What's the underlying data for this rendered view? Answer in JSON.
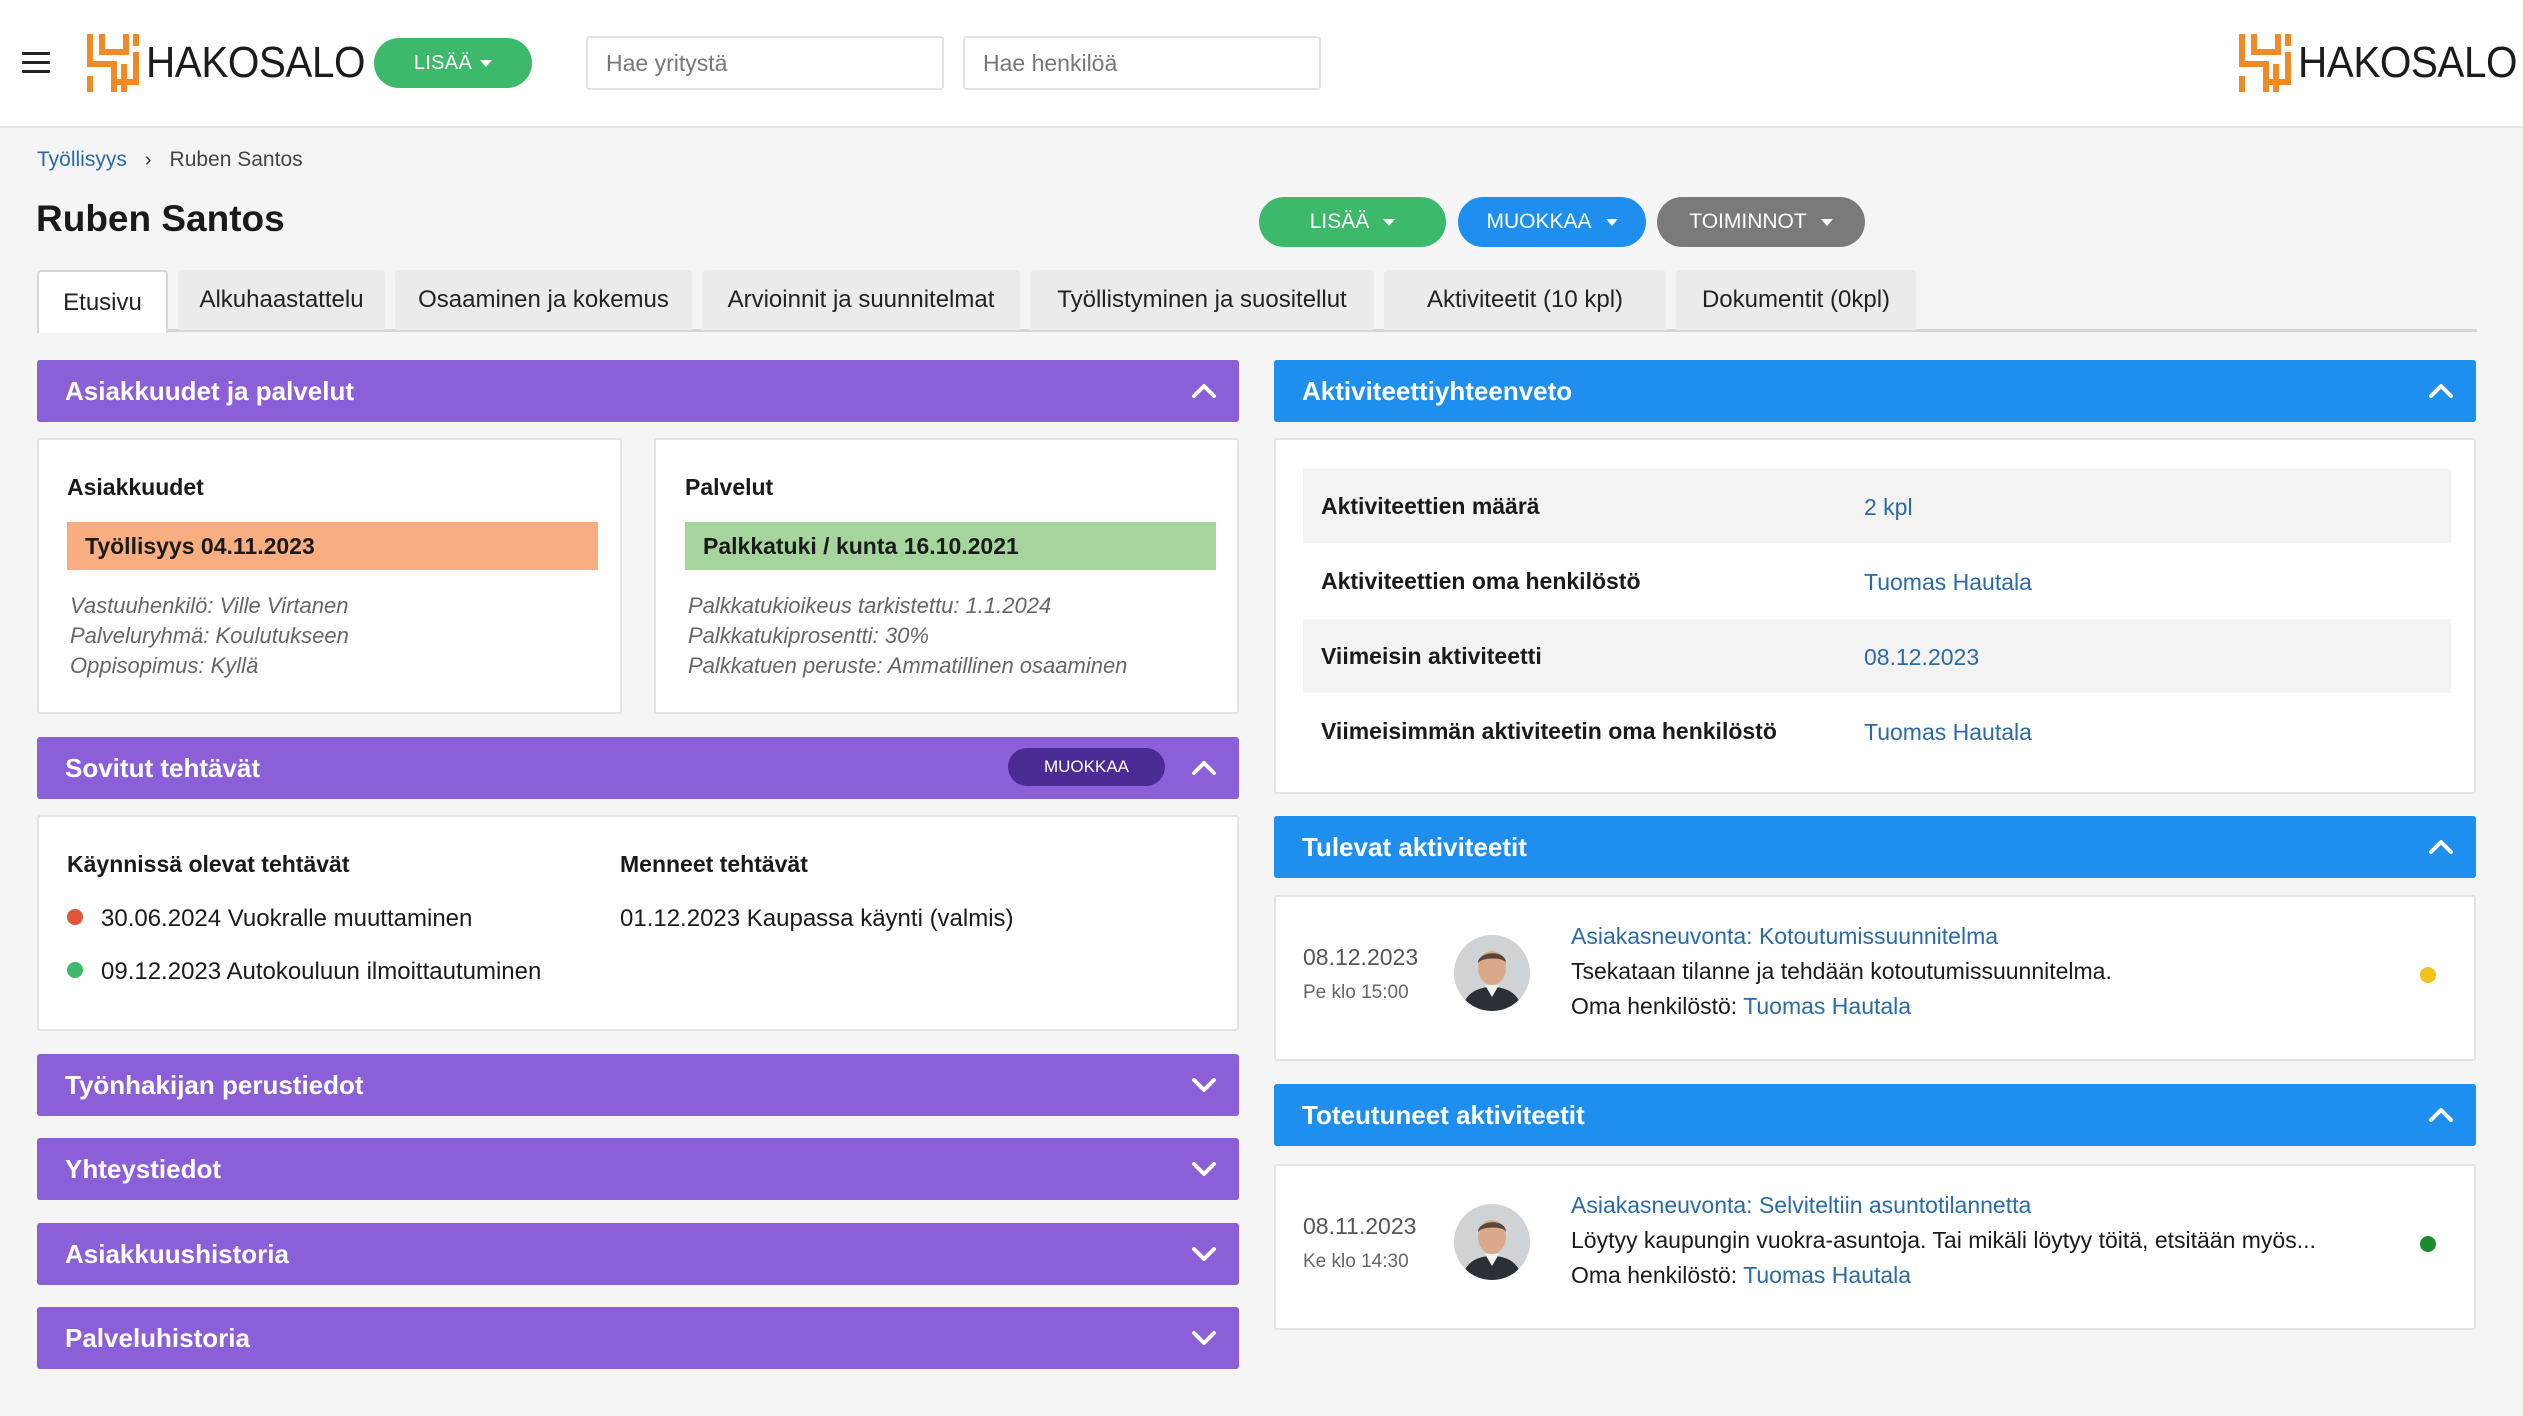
{
  "topbar": {
    "brand": "HAKOSALO",
    "add_label": "LISÄÄ",
    "search_company_placeholder": "Hae yritystä",
    "search_person_placeholder": "Hae henkilöä"
  },
  "breadcrumb": {
    "root": "Työllisyys",
    "separator": "›",
    "current": "Ruben Santos"
  },
  "page": {
    "title": "Ruben Santos"
  },
  "actions": {
    "add": "LISÄÄ",
    "edit": "MUOKKAA",
    "functions": "TOIMINNOT"
  },
  "colors": {
    "purple": "#8b5fd8",
    "blue": "#1e8fef",
    "green": "#3cb96a",
    "grey": "#7a7a7a",
    "link": "#2a6aa8"
  },
  "tabs": [
    {
      "label": "Etusivu",
      "active": true
    },
    {
      "label": "Alkuhaastattelu"
    },
    {
      "label": "Osaaminen ja kokemus"
    },
    {
      "label": "Arvioinnit ja suunnitelmat"
    },
    {
      "label": "Työllistyminen ja suositellut"
    },
    {
      "label": "Aktiviteetit (10 kpl)"
    },
    {
      "label": "Dokumentit (0kpl)"
    }
  ],
  "customers_panel": {
    "title": "Asiakkuudet ja palvelut",
    "customers": {
      "title": "Asiakkuudet",
      "badge": "Työllisyys 04.11.2023",
      "badge_color": "#f9ae82",
      "details": [
        "Vastuuhenkilö: Ville Virtanen",
        "Palveluryhmä: Koulutukseen",
        "Oppisopimus: Kyllä"
      ]
    },
    "services": {
      "title": "Palvelut",
      "badge": "Palkkatuki / kunta 16.10.2021",
      "badge_color": "#a5d59d",
      "details": [
        "Palkkatukioikeus tarkistettu: 1.1.2024",
        "Palkkatukiprosentti: 30%",
        "Palkkatuen peruste: Ammatillinen osaaminen"
      ]
    }
  },
  "tasks_panel": {
    "title": "Sovitut tehtävät",
    "edit_label": "MUOKKAA",
    "ongoing_title": "Käynnissä olevat tehtävät",
    "ongoing": [
      {
        "text": "30.06.2024 Vuokralle muuttaminen",
        "color": "#e0553a"
      },
      {
        "text": "09.12.2023 Autokouluun ilmoittautuminen",
        "color": "#3cb96a"
      }
    ],
    "past_title": "Menneet tehtävät",
    "past": [
      "01.12.2023 Kaupassa käynti (valmis)"
    ]
  },
  "collapsed_panels": [
    "Työnhakijan perustiedot",
    "Yhteystiedot",
    "Asiakkuushistoria",
    "Palveluhistoria"
  ],
  "summary_panel": {
    "title": "Aktiviteettiyhteenveto",
    "rows": [
      {
        "label": "Aktiviteettien määrä",
        "value": "2 kpl"
      },
      {
        "label": "Aktiviteettien oma henkilöstö",
        "value": "Tuomas Hautala"
      },
      {
        "label": "Viimeisin aktiviteetti",
        "value": "08.12.2023"
      },
      {
        "label": "Viimeisimmän aktiviteetin oma henkilöstö",
        "value": "Tuomas Hautala"
      }
    ]
  },
  "upcoming_panel": {
    "title": "Tulevat aktiviteetit",
    "item": {
      "date": "08.12.2023",
      "time": "Pe klo 15:00",
      "link": "Asiakasneuvonta: Kotoutumissuunnitelma",
      "desc": "Tsekataan tilanne ja tehdään kotoutumissuunnitelma.",
      "person_label": "Oma henkilöstö:",
      "person": "Tuomas Hautala",
      "status_color": "#f2c21b"
    }
  },
  "done_panel": {
    "title": "Toteutuneet aktiviteetit",
    "item": {
      "date": "08.11.2023",
      "time": "Ke klo 14:30",
      "link": "Asiakasneuvonta: Selviteltiin asuntotilannetta",
      "desc": "Löytyy kaupungin vuokra-asuntoja. Tai mikäli löytyy töitä, etsitään myös...",
      "person_label": "Oma henkilöstö:",
      "person": "Tuomas Hautala",
      "status_color": "#1a8a2a"
    }
  }
}
